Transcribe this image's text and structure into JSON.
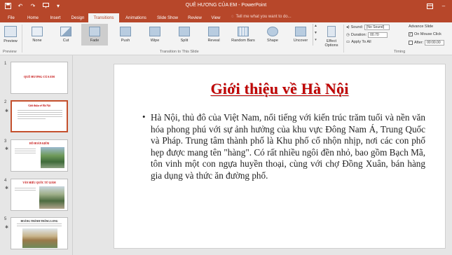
{
  "titlebar": {
    "title": "QUÊ HƯƠNG CỦA EM - PowerPoint",
    "qat_icons": [
      "save-icon",
      "undo-icon",
      "redo-icon",
      "present-icon"
    ],
    "bg_color": "#b7472a"
  },
  "tabs": [
    {
      "label": "File"
    },
    {
      "label": "Home"
    },
    {
      "label": "Insert"
    },
    {
      "label": "Design"
    },
    {
      "label": "Transitions",
      "active": true
    },
    {
      "label": "Animations"
    },
    {
      "label": "Slide Show"
    },
    {
      "label": "Review"
    },
    {
      "label": "View"
    }
  ],
  "tell_me": "Tell me what you want to do...",
  "ribbon": {
    "preview_label": "Preview",
    "preview_group": "Preview",
    "transitions": [
      "None",
      "Cut",
      "Fade",
      "Push",
      "Wipe",
      "Split",
      "Reveal",
      "Random Bars",
      "Shape",
      "Uncover"
    ],
    "selected_transition": "Fade",
    "effect_options_label": "Effect Options",
    "transitions_group": "Transition to This Slide",
    "sound_label": "Sound:",
    "sound_value": "[No Sound]",
    "duration_label": "Duration:",
    "duration_value": "00.70",
    "apply_all_label": "Apply To All",
    "advance_label": "Advance Slide",
    "on_mouse_click_label": "On Mouse Click",
    "on_mouse_click_checked": true,
    "after_label": "After:",
    "after_value": "00:00.00",
    "timing_group": "Timing"
  },
  "thumbnails": [
    {
      "number": "1",
      "title": "QUÊ HƯƠNG CỦA EM",
      "has_star": false
    },
    {
      "number": "2",
      "title": "Giới thiệu về Hà Nội",
      "has_star": true,
      "active": true
    },
    {
      "number": "3",
      "title": "HỒ HOÀN KIẾM",
      "has_star": true
    },
    {
      "number": "4",
      "title": "VĂN MIẾU QUỐC TỬ GIÁM",
      "has_star": true
    },
    {
      "number": "5",
      "title": "HOÀNG THÀNH THĂNG LONG",
      "has_star": true
    }
  ],
  "slide": {
    "title": "Giới thiệu về Hà Nội",
    "bullet": "Hà Nội, thủ đô của Việt Nam, nổi tiếng với kiến trúc trăm tuổi và nền văn hóa phong phú với sự ảnh hưởng của khu vực Đông Nam Á, Trung Quốc và Pháp. Trung tâm thành phố là Khu phố cổ nhộn nhịp, nơi các con phố hẹp được mang tên \"hàng\". Có rất nhiều ngôi đền nhỏ, bao gồm Bạch Mã, tôn vinh một con ngựa huyền thoại, cùng với chợ Đồng Xuân, bán hàng gia dụng và thức ăn đường phố.",
    "title_color": "#c00000"
  }
}
